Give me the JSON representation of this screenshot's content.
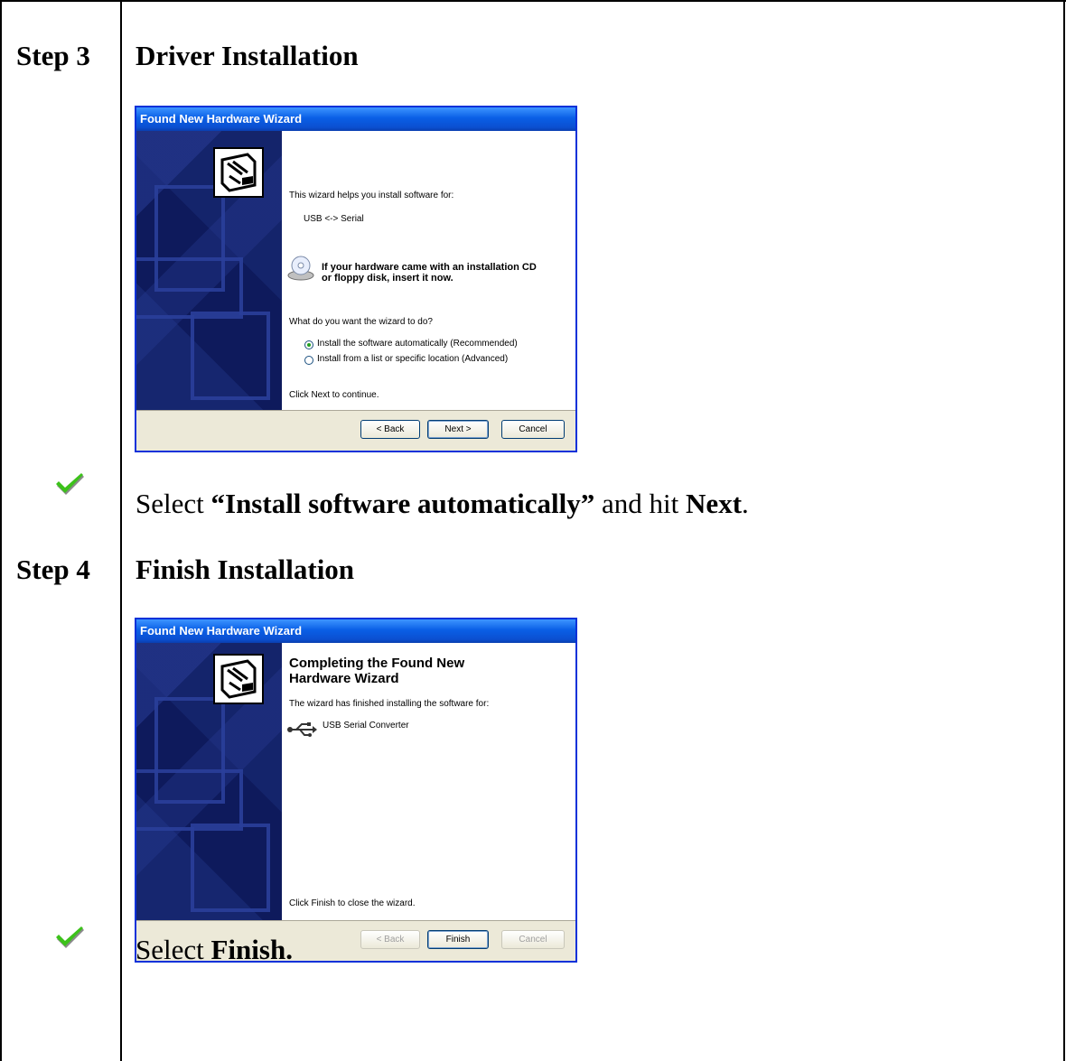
{
  "steps": [
    {
      "label": "Step 3",
      "title": "Driver Installation",
      "wizard": {
        "title": "Found New Hardware Wizard",
        "intro": "This wizard helps you install software for:",
        "device": "USB <-> Serial",
        "cd_note_line1": "If your hardware came with an installation CD",
        "cd_note_line2": "or floppy disk, insert it now.",
        "question": "What do you want the wizard to do?",
        "options": [
          {
            "label": "Install the software automatically (Recommended)",
            "selected": true
          },
          {
            "label": "Install from a list or specific location (Advanced)",
            "selected": false
          }
        ],
        "footer_note": "Click Next to continue.",
        "buttons": {
          "back": "< Back",
          "next": "Next >",
          "cancel": "Cancel"
        }
      },
      "instruction": {
        "prefix": "Select ",
        "bold1": "“Install software automatically”",
        "middle": " and hit ",
        "bold2": "Next",
        "suffix": "."
      }
    },
    {
      "label": "Step 4",
      "title": "Finish Installation",
      "wizard": {
        "title": "Found New Hardware Wizard",
        "heading_line1": "Completing the Found New",
        "heading_line2": "Hardware Wizard",
        "intro": "The wizard has finished installing the software for:",
        "device": "USB Serial Converter",
        "footer_note": "Click Finish to close the wizard.",
        "buttons": {
          "back": "< Back",
          "finish": "Finish",
          "cancel": "Cancel"
        }
      },
      "instruction": {
        "prefix": "Select ",
        "bold1": "Finish."
      }
    }
  ],
  "colors": {
    "check_green": "#3cc21a",
    "xp_title_blue": "#0a5fe6",
    "wizard_side": "#0e1a5c"
  }
}
